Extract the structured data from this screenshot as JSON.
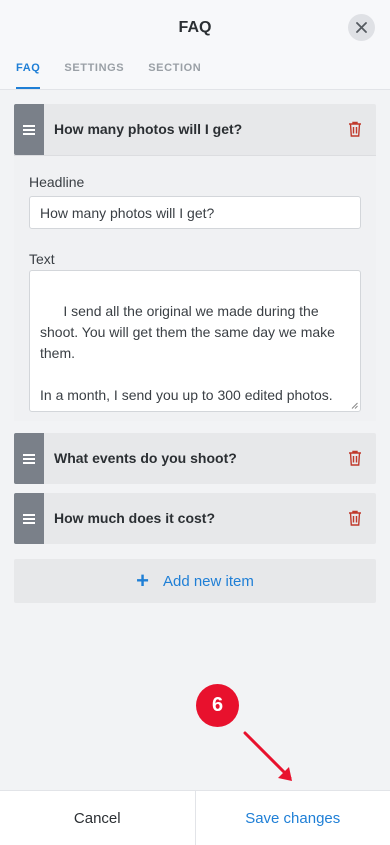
{
  "header": {
    "title": "FAQ",
    "tabs": [
      {
        "label": "FAQ",
        "active": true
      },
      {
        "label": "SETTINGS",
        "active": false
      },
      {
        "label": "SECTION",
        "active": false
      }
    ]
  },
  "items": [
    {
      "title": "How many photos will I get?",
      "expanded": true,
      "headline_label": "Headline",
      "headline_value": "How many photos will I get?",
      "text_label": "Text",
      "text_value": "I send all the original we made during the shoot. You will get them the same day we make them.\n\nIn a month, I send you up to 300 edited photos."
    },
    {
      "title": "What events do you shoot?",
      "expanded": false
    },
    {
      "title": "How much does it cost?",
      "expanded": false
    }
  ],
  "add_item": {
    "label": "Add new item"
  },
  "annotation": {
    "step": "6"
  },
  "footer": {
    "cancel_label": "Cancel",
    "save_label": "Save changes"
  },
  "colors": {
    "accent": "#1f7fd6",
    "danger": "#c0392b",
    "badge": "#e8112d"
  }
}
